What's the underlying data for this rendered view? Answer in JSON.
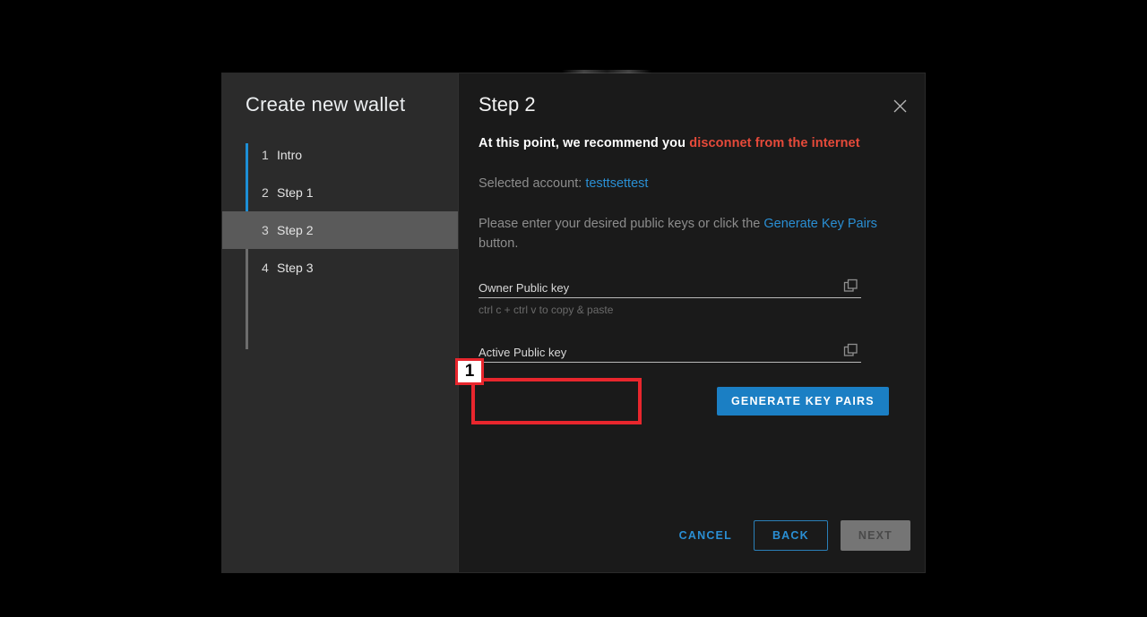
{
  "sidebar": {
    "title": "Create new wallet",
    "items": [
      {
        "num": "1",
        "label": "Intro"
      },
      {
        "num": "2",
        "label": "Step 1"
      },
      {
        "num": "3",
        "label": "Step 2"
      },
      {
        "num": "4",
        "label": "Step 3"
      }
    ]
  },
  "main": {
    "title": "Step 2",
    "close_icon": "close-icon",
    "recommend": {
      "prefix": "At this point, we recommend you ",
      "warning": "disconnet from the internet"
    },
    "selected_account": {
      "label": "Selected account: ",
      "value": "testtsettest"
    },
    "instructions": {
      "part1": "Please enter your desired public keys or click the ",
      "link": "Generate Key Pairs",
      "part2": " button."
    },
    "fields": [
      {
        "label": "Owner Public key",
        "value": "",
        "hint": "ctrl c + ctrl v to copy & paste",
        "copy_icon": "copy-icon"
      },
      {
        "label": "Active Public key",
        "value": "",
        "hint": "",
        "copy_icon": "copy-icon"
      }
    ],
    "generate_button": "GENERATE KEY PAIRS"
  },
  "footer": {
    "cancel": "CANCEL",
    "back": "BACK",
    "next": "NEXT"
  },
  "annotation": {
    "badge": "1"
  },
  "colors": {
    "accent_blue": "#2a8fd4",
    "button_blue": "#1b7fc4",
    "warning_red": "#e64a3a",
    "annotation_red": "#e8262d",
    "sidebar_bg": "#2b2b2b",
    "main_bg": "#1a1a1a",
    "step_active_bg": "#5a5a5a",
    "disabled_gray": "#757575"
  }
}
